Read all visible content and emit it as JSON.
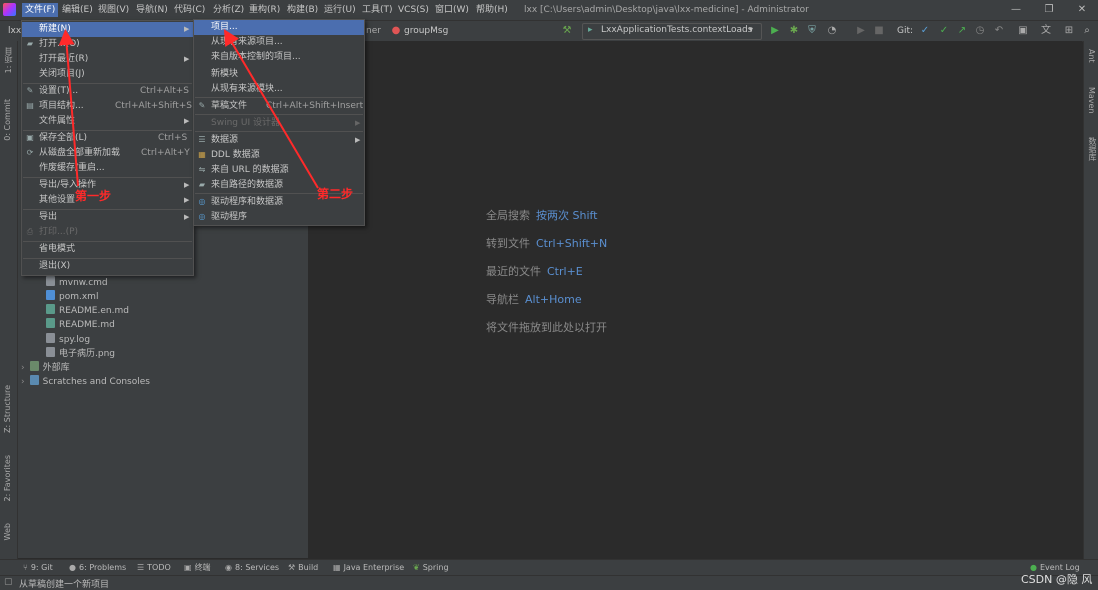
{
  "menubar": {
    "items": [
      "文件(F)",
      "编辑(E)",
      "视图(V)",
      "导航(N)",
      "代码(C)",
      "分析(Z)",
      "重构(R)",
      "构建(B)",
      "运行(U)",
      "工具(T)",
      "VCS(S)",
      "窗口(W)",
      "帮助(H)"
    ],
    "window_title": "lxx [C:\\Users\\admin\\Desktop\\java\\lxx-medicine] - Administrator"
  },
  "toolbar": {
    "project_short": "lxx",
    "breadcrumb_tail": "ner",
    "current_method": "groupMsg",
    "run_config": "LxxApplicationTests.contextLoads",
    "git_label": "Git:"
  },
  "file_menu": {
    "items": [
      {
        "label": "新建(N)",
        "shortcut": "",
        "submenu": true,
        "selected": true,
        "disabled": false,
        "icon": ""
      },
      {
        "label": "打开...(O)",
        "shortcut": "",
        "submenu": false,
        "selected": false,
        "disabled": false,
        "icon": "folder-icon"
      },
      {
        "label": "打开最近(R)",
        "shortcut": "",
        "submenu": true,
        "selected": false,
        "disabled": false,
        "icon": ""
      },
      {
        "label": "关闭项目(J)",
        "shortcut": "",
        "submenu": false,
        "selected": false,
        "disabled": false,
        "icon": ""
      },
      {
        "label": "设置(T)...",
        "shortcut": "Ctrl+Alt+S",
        "submenu": false,
        "selected": false,
        "disabled": false,
        "icon": "wrench-icon"
      },
      {
        "label": "项目结构...",
        "shortcut": "Ctrl+Alt+Shift+S",
        "submenu": false,
        "selected": false,
        "disabled": false,
        "icon": "structure-icon"
      },
      {
        "label": "文件属性",
        "shortcut": "",
        "submenu": true,
        "selected": false,
        "disabled": false,
        "icon": ""
      },
      {
        "label": "保存全部(L)",
        "shortcut": "Ctrl+S",
        "submenu": false,
        "selected": false,
        "disabled": false,
        "icon": "save-icon"
      },
      {
        "label": "从磁盘全部重新加载",
        "shortcut": "Ctrl+Alt+Y",
        "submenu": false,
        "selected": false,
        "disabled": false,
        "icon": "reload-icon"
      },
      {
        "label": "作废缓存/重启...",
        "shortcut": "",
        "submenu": false,
        "selected": false,
        "disabled": false,
        "icon": ""
      },
      {
        "label": "导出/导入操作",
        "shortcut": "",
        "submenu": true,
        "selected": false,
        "disabled": false,
        "icon": ""
      },
      {
        "label": "其他设置",
        "shortcut": "",
        "submenu": true,
        "selected": false,
        "disabled": false,
        "icon": ""
      },
      {
        "label": "导出",
        "shortcut": "",
        "submenu": true,
        "selected": false,
        "disabled": false,
        "icon": ""
      },
      {
        "label": "打印...(P)",
        "shortcut": "",
        "submenu": false,
        "selected": false,
        "disabled": true,
        "icon": "print-icon"
      },
      {
        "label": "省电模式",
        "shortcut": "",
        "submenu": false,
        "selected": false,
        "disabled": false,
        "icon": ""
      },
      {
        "label": "退出(X)",
        "shortcut": "",
        "submenu": false,
        "selected": false,
        "disabled": false,
        "icon": ""
      }
    ]
  },
  "new_submenu": {
    "items": [
      {
        "label": "项目...",
        "shortcut": "",
        "submenu": false,
        "selected": true,
        "disabled": false,
        "icon": ""
      },
      {
        "label": "从现有来源项目...",
        "shortcut": "",
        "submenu": false,
        "selected": false,
        "disabled": false,
        "icon": ""
      },
      {
        "label": "来自版本控制的项目...",
        "shortcut": "",
        "submenu": false,
        "selected": false,
        "disabled": false,
        "icon": ""
      },
      {
        "label": "新模块",
        "shortcut": "",
        "submenu": false,
        "selected": false,
        "disabled": false,
        "icon": ""
      },
      {
        "label": "从现有来源模块...",
        "shortcut": "",
        "submenu": false,
        "selected": false,
        "disabled": false,
        "icon": ""
      },
      {
        "label": "草稿文件",
        "shortcut": "Ctrl+Alt+Shift+Insert",
        "submenu": false,
        "selected": false,
        "disabled": false,
        "icon": "scratch-icon"
      },
      {
        "label": "Swing UI 设计器",
        "shortcut": "",
        "submenu": true,
        "selected": false,
        "disabled": true,
        "icon": ""
      },
      {
        "label": "数据源",
        "shortcut": "",
        "submenu": true,
        "selected": false,
        "disabled": false,
        "icon": "database-icon"
      },
      {
        "label": "DDL 数据源",
        "shortcut": "",
        "submenu": false,
        "selected": false,
        "disabled": false,
        "icon": "ddl-icon"
      },
      {
        "label": "来自 URL 的数据源",
        "shortcut": "",
        "submenu": false,
        "selected": false,
        "disabled": false,
        "icon": "url-icon"
      },
      {
        "label": "来自路径的数据源",
        "shortcut": "",
        "submenu": false,
        "selected": false,
        "disabled": false,
        "icon": "folder-icon"
      },
      {
        "label": "驱动程序和数据源",
        "shortcut": "",
        "submenu": false,
        "selected": false,
        "disabled": false,
        "icon": "driver-icon"
      },
      {
        "label": "驱动程序",
        "shortcut": "",
        "submenu": false,
        "selected": false,
        "disabled": false,
        "icon": "driver-icon"
      }
    ]
  },
  "project_tree": {
    "files": [
      {
        "name": "mvnw.cmd",
        "color": "#8a8f96"
      },
      {
        "name": "pom.xml",
        "color": "#4f8fd6"
      },
      {
        "name": "README.en.md",
        "color": "#5a9a8a"
      },
      {
        "name": "README.md",
        "color": "#5a9a8a"
      },
      {
        "name": "spy.log",
        "color": "#8a8f96"
      },
      {
        "name": "电子病历.png",
        "color": "#8a8f96"
      }
    ],
    "external_libs": "外部库",
    "scratches": "Scratches and Consoles"
  },
  "editor_hints": [
    {
      "label": "全局搜索",
      "key": "按两次 Shift"
    },
    {
      "label": "转到文件",
      "key": "Ctrl+Shift+N"
    },
    {
      "label": "最近的文件",
      "key": "Ctrl+E"
    },
    {
      "label": "导航栏",
      "key": "Alt+Home"
    },
    {
      "label": "将文件拖放到此处以打开",
      "key": ""
    }
  ],
  "annotations": {
    "step1": "第一步",
    "step2": "第二步"
  },
  "left_strip": {
    "project": "1: 项目",
    "commit": "0: Commit",
    "structure": "Z: Structure",
    "favorites": "2: Favorites",
    "web": "Web"
  },
  "right_strip": {
    "ant": "Ant",
    "maven": "Maven",
    "database": "数据库"
  },
  "bottom_tools": [
    {
      "label": "9: Git",
      "icon": "git-icon"
    },
    {
      "label": "6: Problems",
      "icon": "problems-icon"
    },
    {
      "label": "TODO",
      "icon": "todo-icon"
    },
    {
      "label": "终端",
      "icon": "terminal-icon"
    },
    {
      "label": "8: Services",
      "icon": "services-icon"
    },
    {
      "label": "Build",
      "icon": "build-icon"
    },
    {
      "label": "Java Enterprise",
      "icon": "java-enterprise-icon"
    },
    {
      "label": "Spring",
      "icon": "spring-icon"
    }
  ],
  "event_log": "Event Log",
  "status_text": "从草稿创建一个新项目",
  "watermark": "CSDN @隐 风",
  "colors": {
    "accent": "#4b6eaf",
    "annotation": "#ff2a2a",
    "hint_key": "#5a8fd0",
    "run_green": "#4caf50"
  }
}
